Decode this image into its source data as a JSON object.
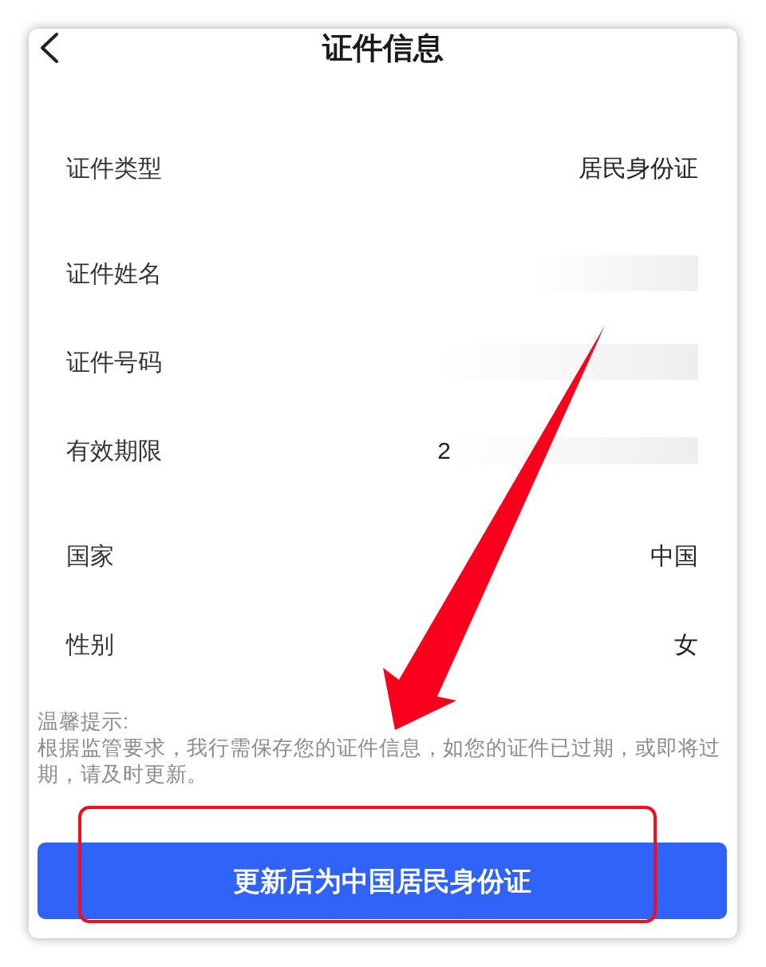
{
  "header": {
    "title": "证件信息"
  },
  "rows": [
    {
      "label": "证件类型",
      "value": "居民身份证",
      "redacted": false
    },
    {
      "label": "证件姓名",
      "redacted": true
    },
    {
      "label": "证件号码",
      "redacted": true
    },
    {
      "label": "有效期限",
      "value": "2",
      "redacted": true
    },
    {
      "label": "国家",
      "value": "中国",
      "redacted": false
    },
    {
      "label": "性别",
      "value": "女",
      "redacted": false
    }
  ],
  "notice": {
    "title": "温馨提示:",
    "text": "根据监管要求，我行需保存您的证件信息，如您的证件已过期，或即将过期，请及时更新。"
  },
  "primary_button": {
    "label": "更新后为中国居民身份证"
  }
}
